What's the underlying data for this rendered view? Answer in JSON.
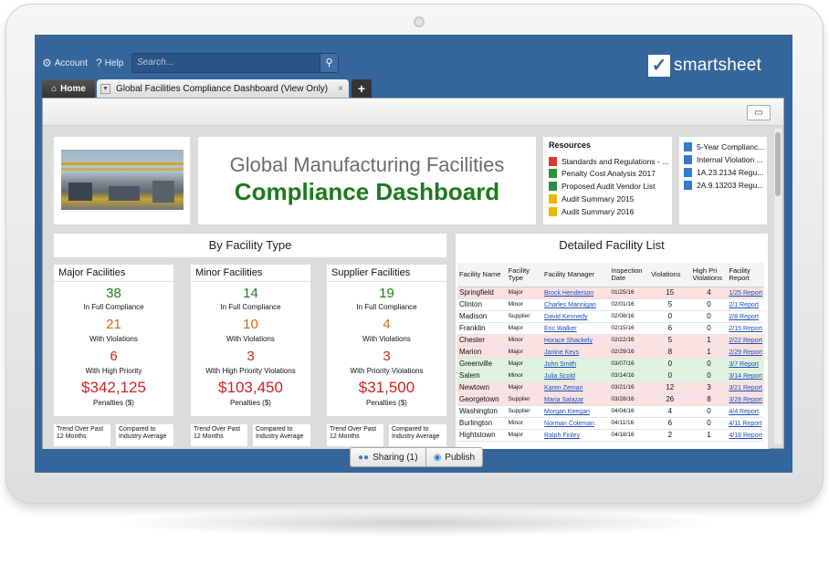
{
  "topbar": {
    "account_label": "Account",
    "help_label": "Help",
    "search_placeholder": "Search...",
    "logo_text": "smartsheet"
  },
  "tabs": {
    "home_label": "Home",
    "sheet_label": "Global Facilities Compliance Dashboard (View Only)",
    "close_label": "×",
    "add_label": "+"
  },
  "header": {
    "title_line1": "Global Manufacturing Facilities",
    "title_line2": "Compliance Dashboard"
  },
  "resources": {
    "heading": "Resources",
    "items": [
      {
        "label": "Standards and Regulations - ...",
        "icon": "pdf-icon"
      },
      {
        "label": "Penalty Cost Analysis 2017",
        "icon": "excel-icon"
      },
      {
        "label": "Proposed Audit Vendor List",
        "icon": "excel-icon"
      },
      {
        "label": "Audit Summary 2015",
        "icon": "doc-icon"
      },
      {
        "label": "Audit Summary 2016",
        "icon": "doc-icon"
      }
    ]
  },
  "links": {
    "items": [
      {
        "label": "5-Year Complianc...",
        "icon": "sheet-icon"
      },
      {
        "label": "Internal Violation ...",
        "icon": "link-icon"
      },
      {
        "label": "1A.23.2134 Regu...",
        "icon": "sheet-icon"
      },
      {
        "label": "2A.9.13203 Regu...",
        "icon": "sheet-icon"
      }
    ]
  },
  "by_type": {
    "title": "By Facility Type",
    "facilities": [
      {
        "name": "Major Facilities",
        "full": "38",
        "full_label": "In Full Compliance",
        "viol": "21",
        "viol_label": "With Violations",
        "prio": "6",
        "prio_label": "With High Priority",
        "penalty": "$342,125",
        "penalty_label": "Penalties ($)",
        "trend": "Trend Over Past 12 Months",
        "compare": "Compared to Industry Average"
      },
      {
        "name": "Minor Facilities",
        "full": "14",
        "full_label": "In Full Compliance",
        "viol": "10",
        "viol_label": "With Violations",
        "prio": "3",
        "prio_label": "With High Priority Violations",
        "penalty": "$103,450",
        "penalty_label": "Penalties ($)",
        "trend": "Trend Over Past 12 Months",
        "compare": "Compared to Industry Average"
      },
      {
        "name": "Supplier Facilities",
        "full": "19",
        "full_label": "In Full Compliance",
        "viol": "4",
        "viol_label": "With Violations",
        "prio": "3",
        "prio_label": "With Priority Violations",
        "penalty": "$31,500",
        "penalty_label": "Penalties ($)",
        "trend": "Trend Over Past 12 Months",
        "compare": "Compared to Industry Average"
      }
    ]
  },
  "detail": {
    "title": "Detailed Facility List",
    "columns": [
      "Facility Name",
      "Facility Type",
      "Facility Manager",
      "Inspection Date",
      "Violations",
      "High Pri Violations",
      "Facility Report"
    ],
    "rows": [
      {
        "name": "Springfield",
        "type": "Major",
        "manager": "Brock Henderson",
        "date": "01/25/16",
        "viol": "15",
        "high": "4",
        "report": "1/25 Report",
        "status": "red"
      },
      {
        "name": "Clinton",
        "type": "Minor",
        "manager": "Charles Mannigan",
        "date": "02/01/16",
        "viol": "5",
        "high": "0",
        "report": "2/1 Report",
        "status": "white"
      },
      {
        "name": "Madison",
        "type": "Supplier",
        "manager": "David Kennedy",
        "date": "02/08/16",
        "viol": "0",
        "high": "0",
        "report": "2/8 Report",
        "status": "white"
      },
      {
        "name": "Franklin",
        "type": "Major",
        "manager": "Eric Walker",
        "date": "02/15/16",
        "viol": "6",
        "high": "0",
        "report": "2/15 Report",
        "status": "white"
      },
      {
        "name": "Chester",
        "type": "Minor",
        "manager": "Horace Shackely",
        "date": "02/22/16",
        "viol": "5",
        "high": "1",
        "report": "2/22 Report",
        "status": "red"
      },
      {
        "name": "Marion",
        "type": "Major",
        "manager": "Janine Keys",
        "date": "02/29/16",
        "viol": "8",
        "high": "1",
        "report": "2/29 Report",
        "status": "red"
      },
      {
        "name": "Greenville",
        "type": "Major",
        "manager": "John Smith",
        "date": "03/07/16",
        "viol": "0",
        "high": "0",
        "report": "3/7 Report",
        "status": "green"
      },
      {
        "name": "Salem",
        "type": "Minor",
        "manager": "Julia Scold",
        "date": "03/14/16",
        "viol": "0",
        "high": "0",
        "report": "3/14 Report",
        "status": "green"
      },
      {
        "name": "Newtown",
        "type": "Major",
        "manager": "Karen Zeman",
        "date": "03/21/16",
        "viol": "12",
        "high": "3",
        "report": "3/21 Report",
        "status": "red"
      },
      {
        "name": "Georgetown",
        "type": "Supplier",
        "manager": "Maria Salazar",
        "date": "03/28/16",
        "viol": "26",
        "high": "8",
        "report": "3/28 Report",
        "status": "red"
      },
      {
        "name": "Washington",
        "type": "Supplier",
        "manager": "Morgan Keegan",
        "date": "04/04/16",
        "viol": "4",
        "high": "0",
        "report": "4/4 Report",
        "status": "white"
      },
      {
        "name": "Burlington",
        "type": "Minor",
        "manager": "Norman Coleman",
        "date": "04/11/16",
        "viol": "6",
        "high": "0",
        "report": "4/11 Report",
        "status": "white"
      },
      {
        "name": "Hightstown",
        "type": "Major",
        "manager": "Ralph Finley",
        "date": "04/18/16",
        "viol": "2",
        "high": "1",
        "report": "4/18 Report",
        "status": "white"
      }
    ]
  },
  "bottom": {
    "sharing_label": "Sharing (1)",
    "publish_label": "Publish"
  },
  "colors": {
    "frame_blue": "#35669b",
    "compliance_green": "#1c7a1c",
    "violation_orange": "#d26a12",
    "priority_red": "#d51f1f"
  }
}
